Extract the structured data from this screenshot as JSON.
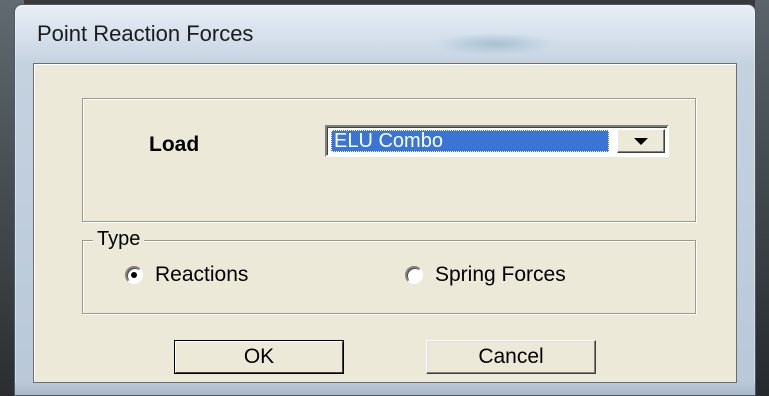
{
  "window": {
    "title": "Point Reaction Forces"
  },
  "load": {
    "label": "Load",
    "selected": "ELU Combo"
  },
  "type_group": {
    "legend": "Type",
    "options": [
      {
        "label": "Reactions",
        "checked": true
      },
      {
        "label": "Spring Forces",
        "checked": false
      }
    ]
  },
  "buttons": {
    "ok": "OK",
    "cancel": "Cancel"
  },
  "icons": {
    "dropdown": "chevron-down-icon",
    "radio_selected": "radio-selected-icon",
    "radio_unselected": "radio-unselected-icon"
  },
  "colors": {
    "selection": "#3a75d6",
    "dialog_face": "#ece9d8",
    "titlebar": "#d6e1ec"
  }
}
